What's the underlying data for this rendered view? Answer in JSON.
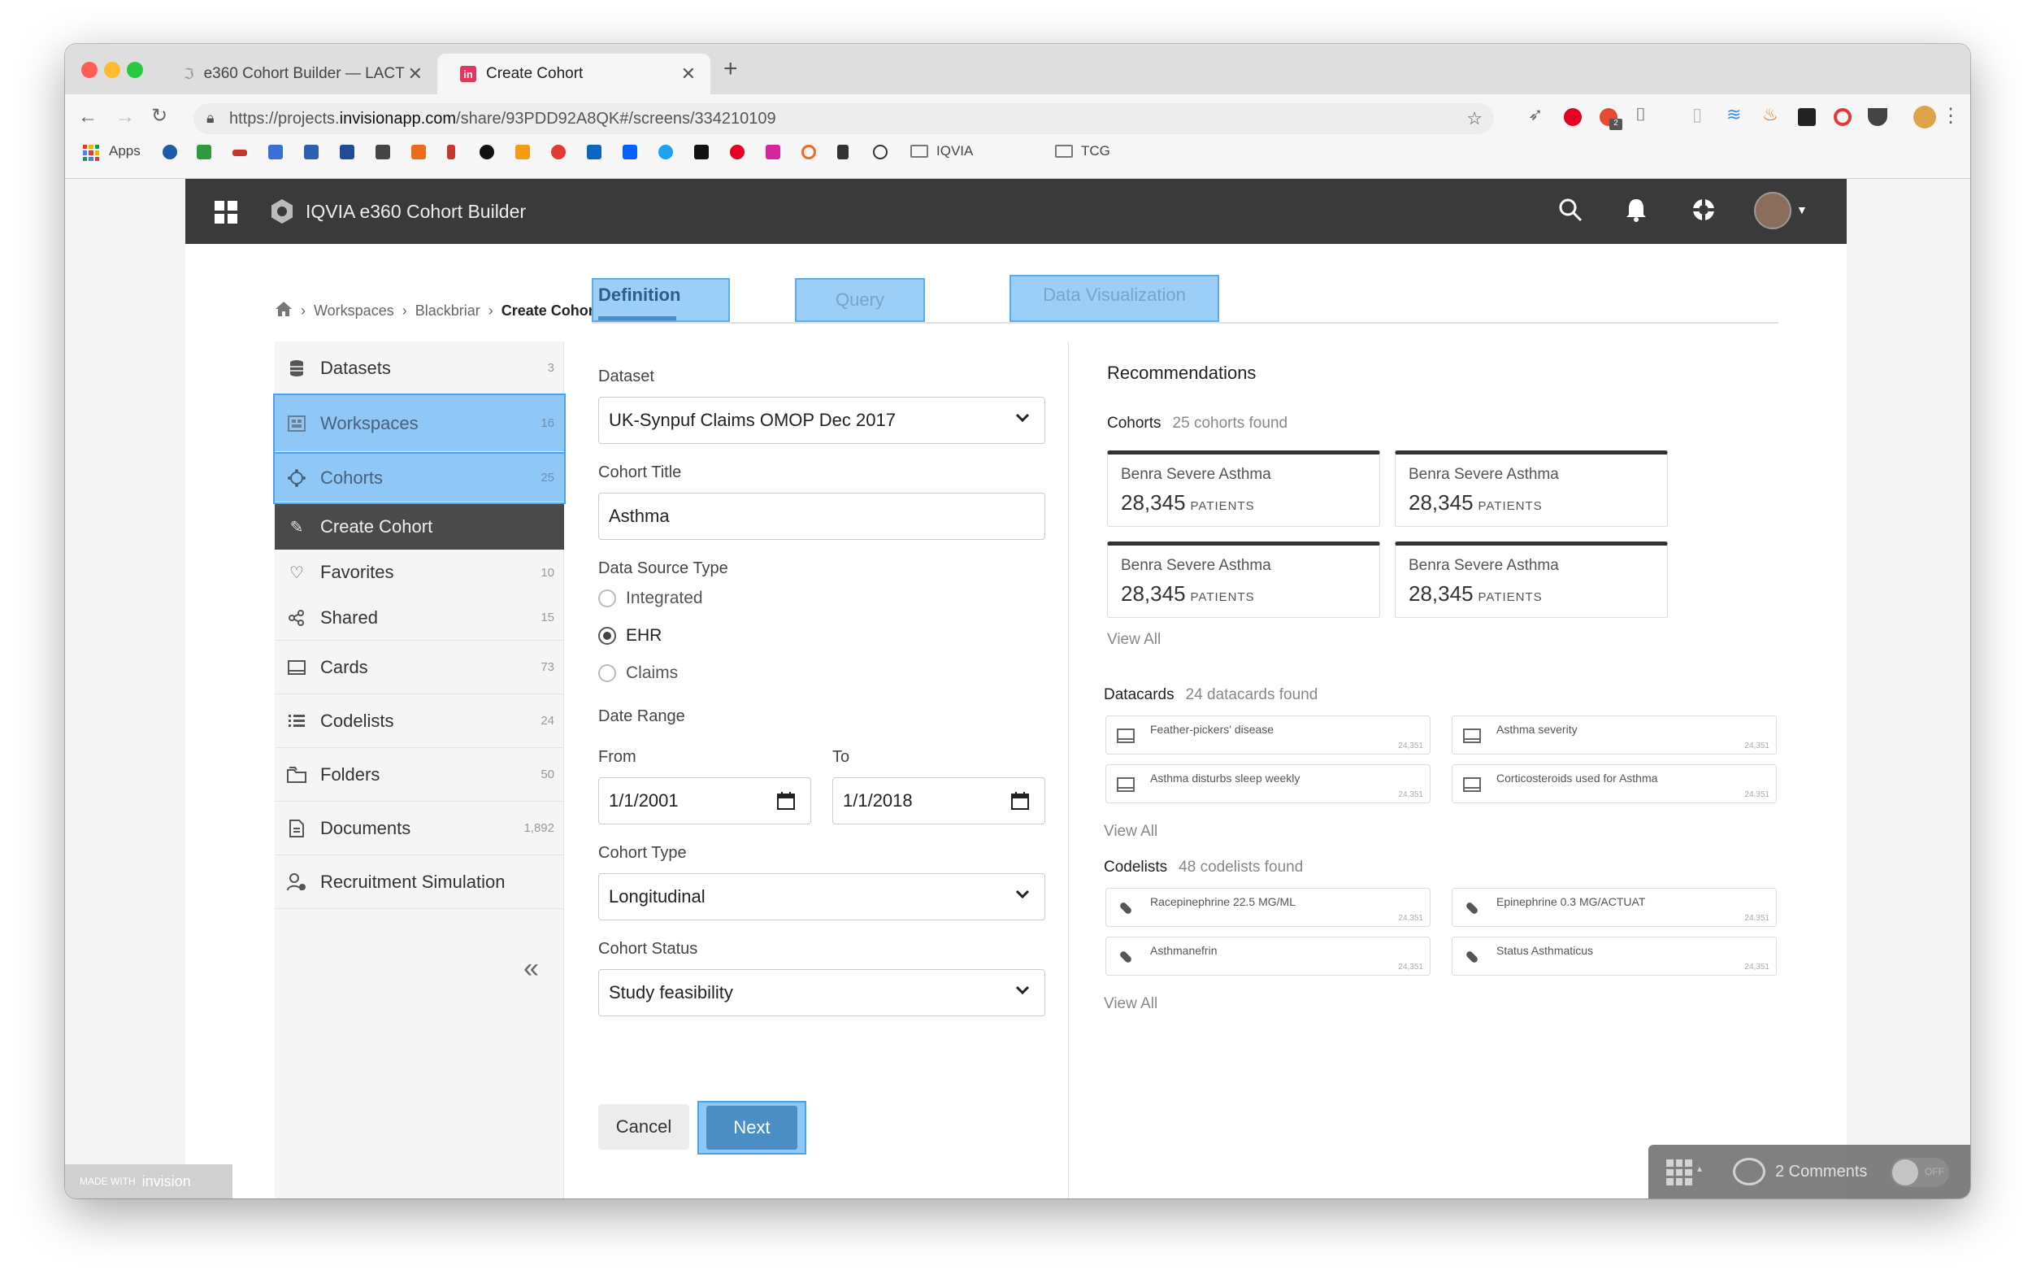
{
  "browser": {
    "tabs": [
      {
        "title": "e360 Cohort Builder — LACT"
      },
      {
        "title": "Create Cohort"
      }
    ],
    "url_prefix": "https://projects.",
    "url_domain": "invisionapp.com",
    "url_path": "/share/93PDD92A8QK#/screens/334210109",
    "bookmarks": [
      {
        "label": "Apps"
      },
      {
        "label": "IQVIA"
      },
      {
        "label": "TCG"
      }
    ],
    "extension_badge": "2"
  },
  "header": {
    "title": "IQVIA e360 Cohort Builder"
  },
  "breadcrumb": {
    "items": [
      "Workspaces",
      "Blackbriar"
    ],
    "current": "Create Cohort"
  },
  "sidebar": {
    "items": [
      {
        "label": "Datasets",
        "count": "3",
        "icon": "database-icon"
      },
      {
        "label": "Workspaces",
        "count": "16",
        "icon": "workspace-icon"
      },
      {
        "label": "Cohorts",
        "count": "25",
        "icon": "cohort-icon"
      },
      {
        "label": "Create Cohort",
        "count": "",
        "icon": "pencil-icon"
      },
      {
        "label": "Favorites",
        "count": "10",
        "icon": "heart-icon"
      },
      {
        "label": "Shared",
        "count": "15",
        "icon": "share-icon"
      },
      {
        "label": "Cards",
        "count": "73",
        "icon": "card-icon"
      },
      {
        "label": "Codelists",
        "count": "24",
        "icon": "codelist-icon"
      },
      {
        "label": "Folders",
        "count": "50",
        "icon": "folder-icon"
      },
      {
        "label": "Documents",
        "count": "1,892",
        "icon": "document-icon"
      },
      {
        "label": "Recruitment Simulation",
        "count": "",
        "icon": "recruit-icon"
      }
    ]
  },
  "tabs": [
    {
      "label": "Definition"
    },
    {
      "label": "Query"
    },
    {
      "label": "Data Visualization"
    }
  ],
  "form": {
    "dataset_label": "Dataset",
    "dataset_value": "UK-Synpuf Claims OMOP Dec 2017",
    "title_label": "Cohort Title",
    "title_value": "Asthma",
    "source_label": "Data Source Type",
    "source_options": [
      "Integrated",
      "EHR",
      "Claims"
    ],
    "source_selected": "EHR",
    "date_label": "Date Range",
    "from_label": "From",
    "from_value": "1/1/2001",
    "to_label": "To",
    "to_value": "1/1/2018",
    "type_label": "Cohort Type",
    "type_value": "Longitudinal",
    "status_label": "Cohort Status",
    "status_value": "Study feasibility",
    "cancel_label": "Cancel",
    "next_label": "Next"
  },
  "recommendations": {
    "title": "Recommendations",
    "cohorts_label": "Cohorts",
    "cohorts_found": "25 cohorts found",
    "cohort_cards": [
      {
        "name": "Benra Severe Asthma",
        "count": "28,345",
        "unit": "PATIENTS"
      },
      {
        "name": "Benra Severe Asthma",
        "count": "28,345",
        "unit": "PATIENTS"
      },
      {
        "name": "Benra Severe Asthma",
        "count": "28,345",
        "unit": "PATIENTS"
      },
      {
        "name": "Benra Severe Asthma",
        "count": "28,345",
        "unit": "PATIENTS"
      }
    ],
    "view_all": "View All",
    "datacards_label": "Datacards",
    "datacards_found": "24 datacards found",
    "datacards": [
      {
        "name": "Feather-pickers' disease",
        "count": "24,351"
      },
      {
        "name": "Asthma severity",
        "count": "24,351"
      },
      {
        "name": "Asthma disturbs sleep weekly",
        "count": "24,351"
      },
      {
        "name": "Corticosteroids used for Asthma",
        "count": "24,351"
      }
    ],
    "codelists_label": "Codelists",
    "codelists_found": "48 codelists found",
    "codelists": [
      {
        "name": "Racepinephrine 22.5 MG/ML",
        "count": "24,351"
      },
      {
        "name": "Epinephrine 0.3 MG/ACTUAT",
        "count": "24,351"
      },
      {
        "name": "Asthmanefrin",
        "count": "24,351"
      },
      {
        "name": "Status Asthmaticus",
        "count": "24,351"
      }
    ]
  },
  "invision": {
    "made_with": "MADE WITH",
    "brand": "invision",
    "comments": "2 Comments",
    "toggle": "OFF"
  },
  "colors": {
    "header_bg": "#3a3a3a",
    "highlight": "#8fc8f7",
    "next_button": "#4a8ec4"
  }
}
